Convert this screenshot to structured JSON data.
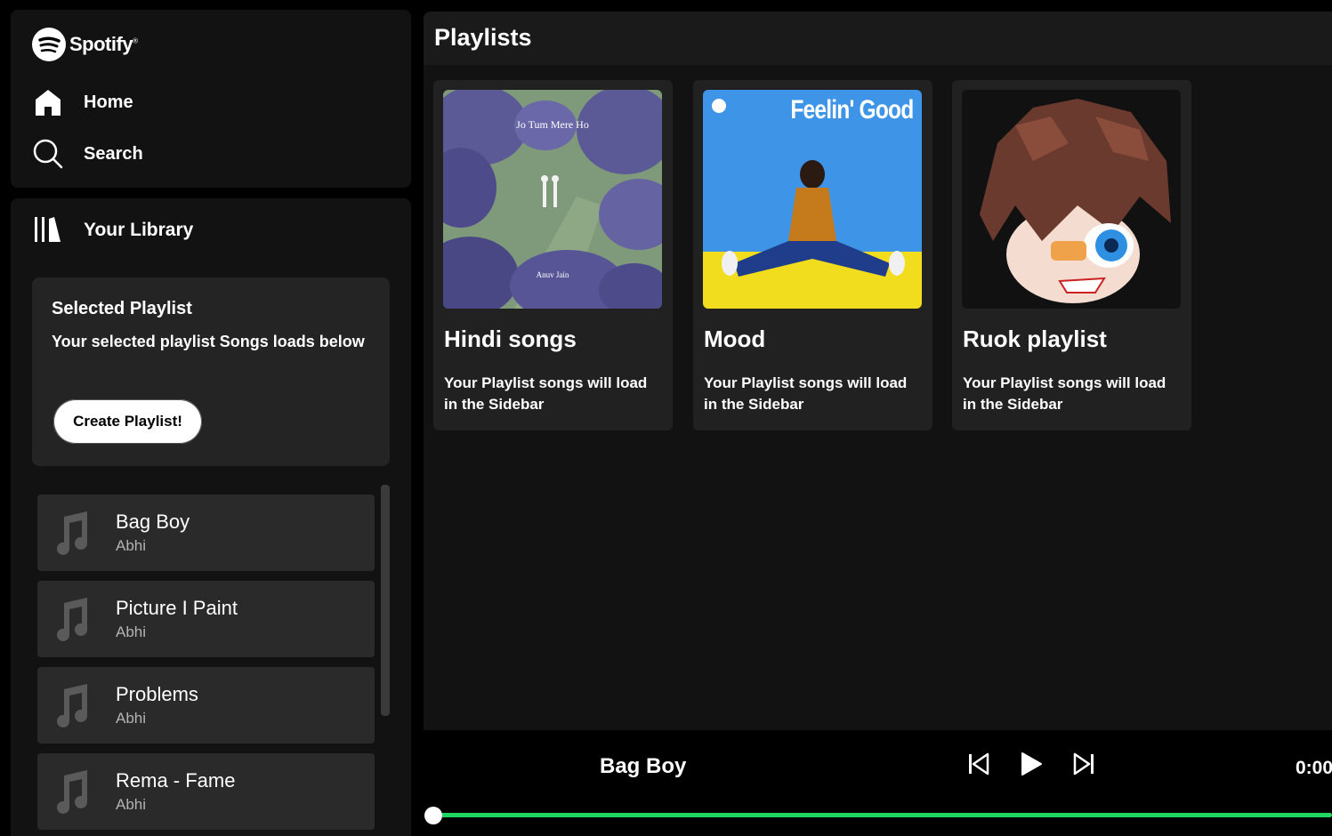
{
  "brand": {
    "name": "Spotify",
    "mark": "®"
  },
  "nav": {
    "home": {
      "label": "Home",
      "icon": "home-icon"
    },
    "search": {
      "label": "Search",
      "icon": "search-icon"
    }
  },
  "library": {
    "title": "Your Library",
    "icon": "library-icon",
    "selected": {
      "title": "Selected Playlist",
      "subtitle": "Your selected playlist Songs loads below",
      "create_label": "Create Playlist!"
    },
    "songs": [
      {
        "name": "Bag Boy",
        "artist": "Abhi"
      },
      {
        "name": "Picture I Paint",
        "artist": "Abhi"
      },
      {
        "name": "Problems",
        "artist": "Abhi"
      },
      {
        "name": "Rema - Fame",
        "artist": "Abhi"
      }
    ]
  },
  "main": {
    "title": "Playlists",
    "playlists": [
      {
        "name": "Hindi songs",
        "desc": "Your Playlist songs will load in the Sidebar",
        "cover_title": "Jo Tum Mere Ho",
        "cover_artist": "Anuv Jain"
      },
      {
        "name": "Mood",
        "desc": "Your Playlist songs will load in the Sidebar",
        "cover_title": "Feelin' Good"
      },
      {
        "name": "Ruok playlist",
        "desc": "Your Playlist songs will load in the Sidebar"
      }
    ]
  },
  "player": {
    "title": "Bag Boy",
    "time": "0:00",
    "progress": 0,
    "accent": "#1ed760"
  }
}
